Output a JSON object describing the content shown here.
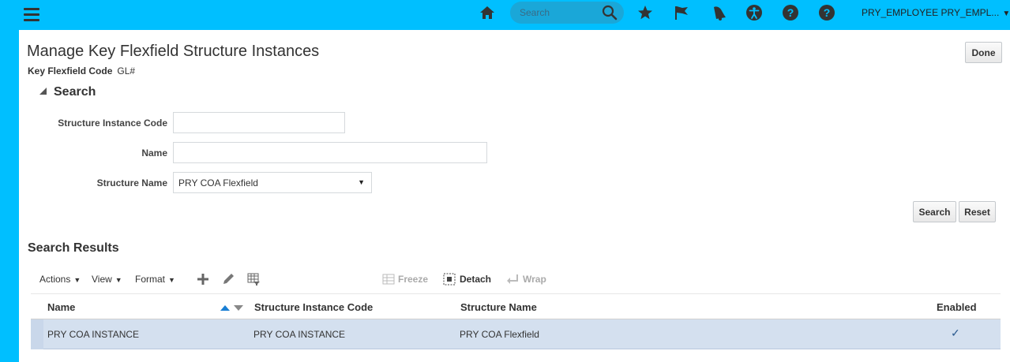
{
  "topbar": {
    "search_placeholder": "Search",
    "user_label": "PRY_EMPLOYEE PRY_EMPL...",
    "icons": [
      "home-icon",
      "search-icon",
      "star-icon",
      "flag-icon",
      "bell-icon",
      "accessibility-icon",
      "help-icon",
      "help-icon"
    ]
  },
  "page": {
    "title": "Manage Key Flexfield Structure Instances",
    "key_flexfield_label": "Key Flexfield Code",
    "key_flexfield_value": "GL#",
    "done_label": "Done"
  },
  "search": {
    "header": "Search",
    "fields": {
      "structure_instance_code_label": "Structure Instance Code",
      "structure_instance_code_value": "",
      "name_label": "Name",
      "name_value": "",
      "structure_name_label": "Structure Name",
      "structure_name_value": "PRY COA Flexfield"
    },
    "search_button": "Search",
    "reset_button": "Reset"
  },
  "results": {
    "header": "Search Results",
    "toolbar": {
      "actions": "Actions",
      "view": "View",
      "format": "Format",
      "freeze": "Freeze",
      "detach": "Detach",
      "wrap": "Wrap"
    },
    "columns": [
      "Name",
      "Structure Instance Code",
      "Structure Name",
      "Enabled"
    ],
    "rows": [
      {
        "name": "PRY COA INSTANCE",
        "code": "PRY COA INSTANCE",
        "structure_name": "PRY COA Flexfield",
        "enabled": "✓"
      }
    ]
  },
  "colors": {
    "brand": "#00bfff",
    "selected_row": "#d4e0ef",
    "sort_active": "#1a7fd4"
  }
}
